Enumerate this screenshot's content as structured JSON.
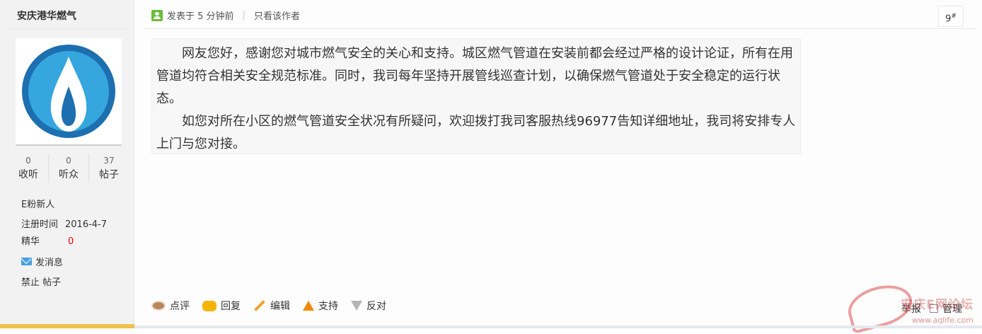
{
  "author": {
    "name": "安庆港华燃气",
    "avatar_colors": {
      "outer": "#1d6fb0",
      "inner": "#35a6de",
      "flame": "#ffffff"
    },
    "stats": [
      {
        "value": "0",
        "label": "收听"
      },
      {
        "value": "0",
        "label": "听众"
      },
      {
        "value": "37",
        "label": "帖子"
      }
    ],
    "level": "E粉新人",
    "register_label": "注册时间",
    "register_date": "2016-4-7",
    "digest_label": "精华",
    "digest_value": "0",
    "message_label": "发消息",
    "ban_label": "禁止",
    "posts_label": "帖子"
  },
  "post": {
    "time_text": "发表于 5 分钟前",
    "separator": "|",
    "only_author": "只看该作者",
    "floor_number": "9",
    "floor_mark": "#",
    "paragraphs": [
      "网友您好，感谢您对城市燃气安全的关心和支持。城区燃气管道在安装前都会经过严格的设计论证，所有在用管道均符合相关安全规范标准。同时，我司每年坚持开展管线巡查计划，以确保燃气管道处于安全稳定的运行状态。",
      "如您对所在小区的燃气管道安全状况有所疑问，欢迎拨打我司客服热线96977告知详细地址，我司将安排专人上门与您对接。"
    ]
  },
  "actions": {
    "comment": "点评",
    "reply": "回复",
    "edit": "编辑",
    "support": "支持",
    "oppose": "反对",
    "report": "举报",
    "manage": "管理"
  },
  "watermark": {
    "text": "安庆E网论坛",
    "url": "www.aqlife.com"
  }
}
